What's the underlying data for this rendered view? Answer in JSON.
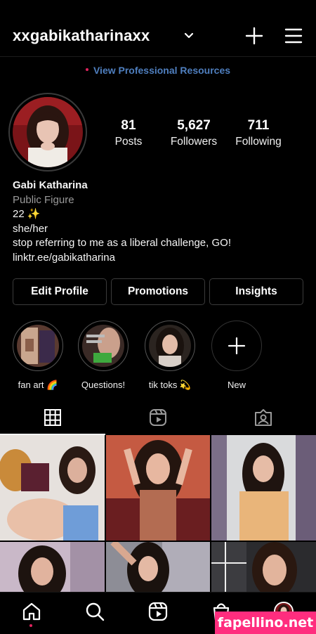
{
  "header": {
    "username": "xxgabikatharinaxx",
    "icons": {
      "dropdown": "chevron-down-icon",
      "create": "plus-icon",
      "menu": "hamburger-menu-icon"
    }
  },
  "professional_link": "View Professional Resources",
  "profile": {
    "stats": [
      {
        "value": "81",
        "label": "Posts"
      },
      {
        "value": "5,627",
        "label": "Followers"
      },
      {
        "value": "711",
        "label": "Following"
      }
    ],
    "name": "Gabi Katharina",
    "category": "Public Figure",
    "bio_lines": [
      "22 ✨",
      "she/her",
      "stop referring to me as a liberal challenge, GO!"
    ],
    "link": "linktr.ee/gabikatharina"
  },
  "buttons": {
    "edit": "Edit Profile",
    "promotions": "Promotions",
    "insights": "Insights"
  },
  "highlights": [
    {
      "label": "fan art 🌈"
    },
    {
      "label": "Questions!"
    },
    {
      "label": "tik toks 💫"
    },
    {
      "label": "New"
    }
  ],
  "tabs": [
    "grid-icon",
    "reels-icon",
    "tagged-icon"
  ],
  "bottom_nav": [
    "home-icon",
    "search-icon",
    "reels-icon",
    "shop-icon",
    "profile-avatar"
  ],
  "watermark": "fapellino.net",
  "colors": {
    "background": "#000000",
    "link_blue": "#4f7fbf",
    "notification_dot": "#e0245e",
    "watermark_pink": "#ff2d7e"
  }
}
